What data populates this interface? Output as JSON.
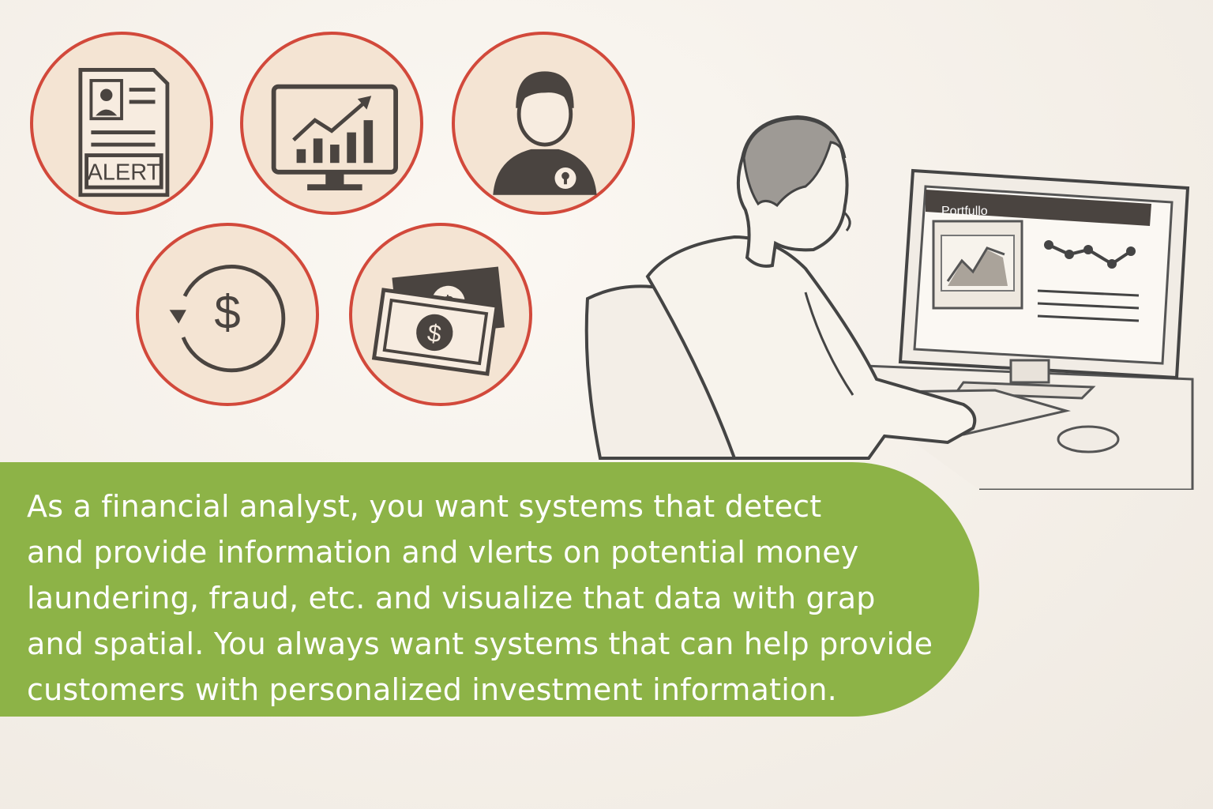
{
  "icons": [
    {
      "name": "alert-document-icon",
      "label": "ALERT"
    },
    {
      "name": "rising-chart-monitor-icon"
    },
    {
      "name": "user-lock-icon"
    },
    {
      "name": "dollar-cycle-icon"
    },
    {
      "name": "banknotes-icon"
    }
  ],
  "illustration": {
    "screen_title": "Portfullo"
  },
  "banner": {
    "text": "As a financial analyst, you want systems that detect\nand provide information and vlerts on potential money\nlaundering, fraud, etc. and visualize that data with grap\nand spatial. You always want systems that can help provide\ncustomers with personalized investment information."
  },
  "colors": {
    "circle_border": "#d2493b",
    "circle_fill": "#f4e4d3",
    "icon_dark": "#4a4440",
    "banner_green": "#8db347",
    "banner_text": "#ffffff"
  }
}
